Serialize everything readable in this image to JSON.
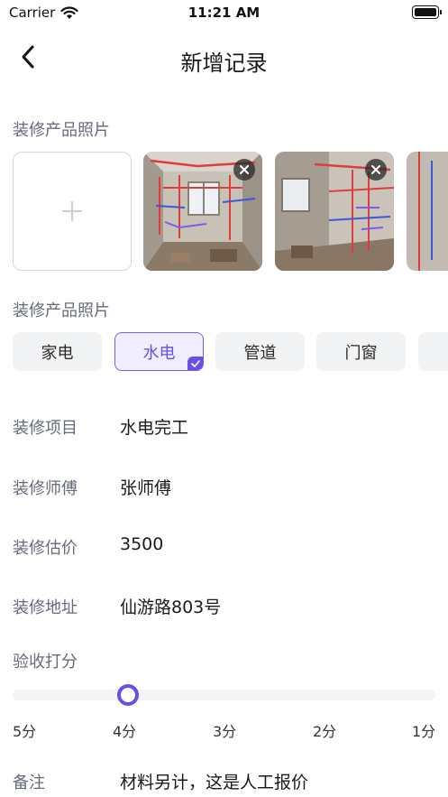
{
  "status_bar": {
    "carrier": "Carrier",
    "time": "11:21 AM"
  },
  "nav": {
    "title": "新增记录"
  },
  "photos_section": {
    "label": "装修产品照片",
    "photo_count_visible": 3
  },
  "category_section": {
    "label": "装修产品照片",
    "options": [
      "家电",
      "水电",
      "管道",
      "门窗"
    ],
    "selected": "水电"
  },
  "fields": {
    "project": {
      "label": "装修项目",
      "value": "水电完工"
    },
    "worker": {
      "label": "装修师傅",
      "value": "张师傅"
    },
    "price": {
      "label": "装修估价",
      "value": "3500"
    },
    "address": {
      "label": "装修地址",
      "value": "仙游路803号"
    }
  },
  "rating": {
    "label": "验收打分",
    "scale": [
      "5分",
      "4分",
      "3分",
      "2分",
      "1分"
    ],
    "selected": "4分",
    "selected_fraction": 0.25
  },
  "notes": {
    "label": "备注",
    "value": "材料另计，这是人工报价"
  },
  "colors": {
    "accent": "#6b4ee6",
    "label_gray": "#666a7a",
    "chip_bg": "#f2f3f5"
  },
  "icons": {
    "back": "chevron-left-icon",
    "add": "plus-icon",
    "remove": "close-icon",
    "check": "check-icon"
  }
}
